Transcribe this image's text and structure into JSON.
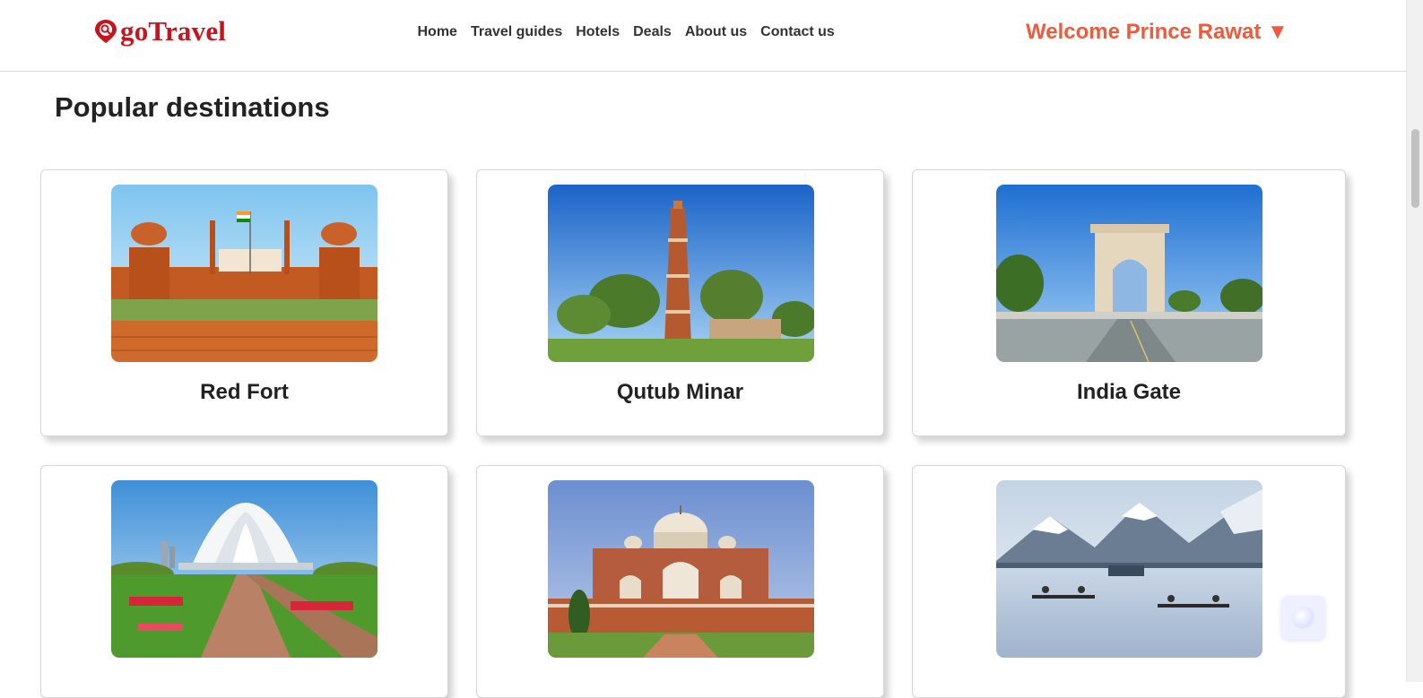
{
  "header": {
    "logo_text": "goTravel",
    "nav": [
      "Home",
      "Travel guides",
      "Hotels",
      "Deals",
      "About us",
      "Contact us"
    ],
    "welcome": "Welcome Prince Rawat ▼"
  },
  "main": {
    "title": "Popular destinations",
    "destinations": [
      {
        "name": "Red Fort"
      },
      {
        "name": "Qutub Minar"
      },
      {
        "name": "India Gate"
      },
      {
        "name": ""
      },
      {
        "name": ""
      },
      {
        "name": ""
      }
    ]
  },
  "colors": {
    "brand": "#c8141e",
    "welcome": "#ef5a3c"
  },
  "icons": {
    "logo": "map-pin-search-icon",
    "floating": "chat-bubble-icon"
  }
}
